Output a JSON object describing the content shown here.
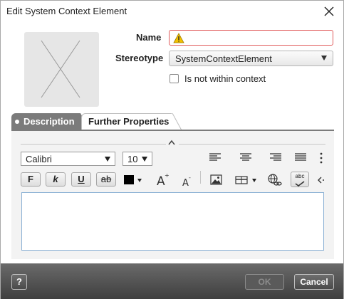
{
  "window": {
    "title": "Edit System Context Element"
  },
  "form": {
    "name_label": "Name",
    "name_value": "",
    "stereotype_label": "Stereotype",
    "stereotype_value": "SystemContextElement",
    "not_within_context_label": "Is not within context",
    "not_within_context_checked": false
  },
  "tabs": [
    {
      "label": "Description",
      "active": true
    },
    {
      "label": "Further Properties",
      "active": false
    }
  ],
  "editor": {
    "font_family": "Calibri",
    "font_size": "10",
    "bold_label": "F",
    "italic_label": "k",
    "underline_label": "U",
    "strike_label": "ab",
    "text_color": "#000000",
    "spell_label": "abc",
    "content": ""
  },
  "footer": {
    "help_label": "?",
    "ok_label": "OK",
    "cancel_label": "Cancel"
  },
  "colors": {
    "error_border": "#e05a5a",
    "active_tab": "#7b7b7b",
    "footer_bg": "#4f4f4f",
    "warning": "#f2c200"
  }
}
